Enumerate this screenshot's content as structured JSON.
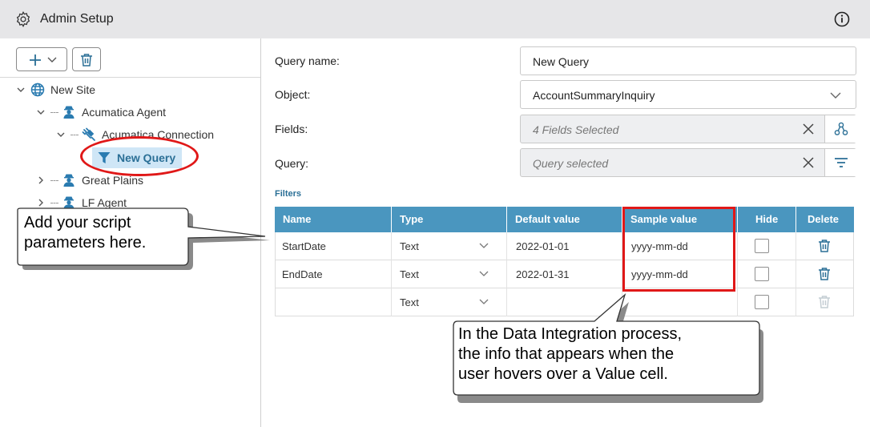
{
  "header": {
    "title": "Admin Setup",
    "left_icon": "gear-icon",
    "right_icon": "info-icon"
  },
  "sidebar": {
    "add_icon": "plus-icon",
    "add_menu_icon": "chevron-down-icon",
    "delete_icon": "trash-icon",
    "tree": [
      {
        "label": "New Site",
        "icon": "globe-icon",
        "expanded": true
      },
      {
        "label": "Acumatica Agent",
        "icon": "agent-icon",
        "expanded": true
      },
      {
        "label": "Acumatica Connection",
        "icon": "plug-icon",
        "expanded": true
      },
      {
        "label": "New Query",
        "icon": "filter-icon",
        "selected": true
      },
      {
        "label": "Great Plains",
        "icon": "agent-icon",
        "expanded": false
      },
      {
        "label": "LF Agent",
        "icon": "agent-icon",
        "expanded": false
      }
    ]
  },
  "form": {
    "query_name_label": "Query name:",
    "query_name_value": "New Query",
    "object_label": "Object:",
    "object_value": "AccountSummaryInquiry",
    "fields_label": "Fields:",
    "fields_value": "4 Fields Selected",
    "query_label": "Query:",
    "query_value": "Query selected"
  },
  "filters": {
    "title": "Filters",
    "columns": [
      "Name",
      "Type",
      "Default value",
      "Sample value",
      "Hide",
      "Delete"
    ],
    "rows": [
      {
        "name": "StartDate",
        "type": "Text",
        "default_value": "2022-01-01",
        "sample_value": "yyyy-mm-dd",
        "hide": false
      },
      {
        "name": "EndDate",
        "type": "Text",
        "default_value": "2022-01-31",
        "sample_value": "yyyy-mm-dd",
        "hide": false
      },
      {
        "name": "",
        "type": "Text",
        "default_value": "",
        "sample_value": "",
        "hide": false
      }
    ]
  },
  "annotations": {
    "callout_left_line1": "Add your script",
    "callout_left_line2": "parameters here.",
    "callout_bottom_line1": "In the Data Integration process,",
    "callout_bottom_line2": "the info that appears when the",
    "callout_bottom_line3": "user hovers over a Value cell.",
    "highlight_color": "#e01818"
  },
  "colors": {
    "header_bg": "#e6e6e8",
    "grid_header_bg": "#4a96bf",
    "selected_node_bg": "#cfe6f6",
    "accent": "#2a6f96"
  }
}
